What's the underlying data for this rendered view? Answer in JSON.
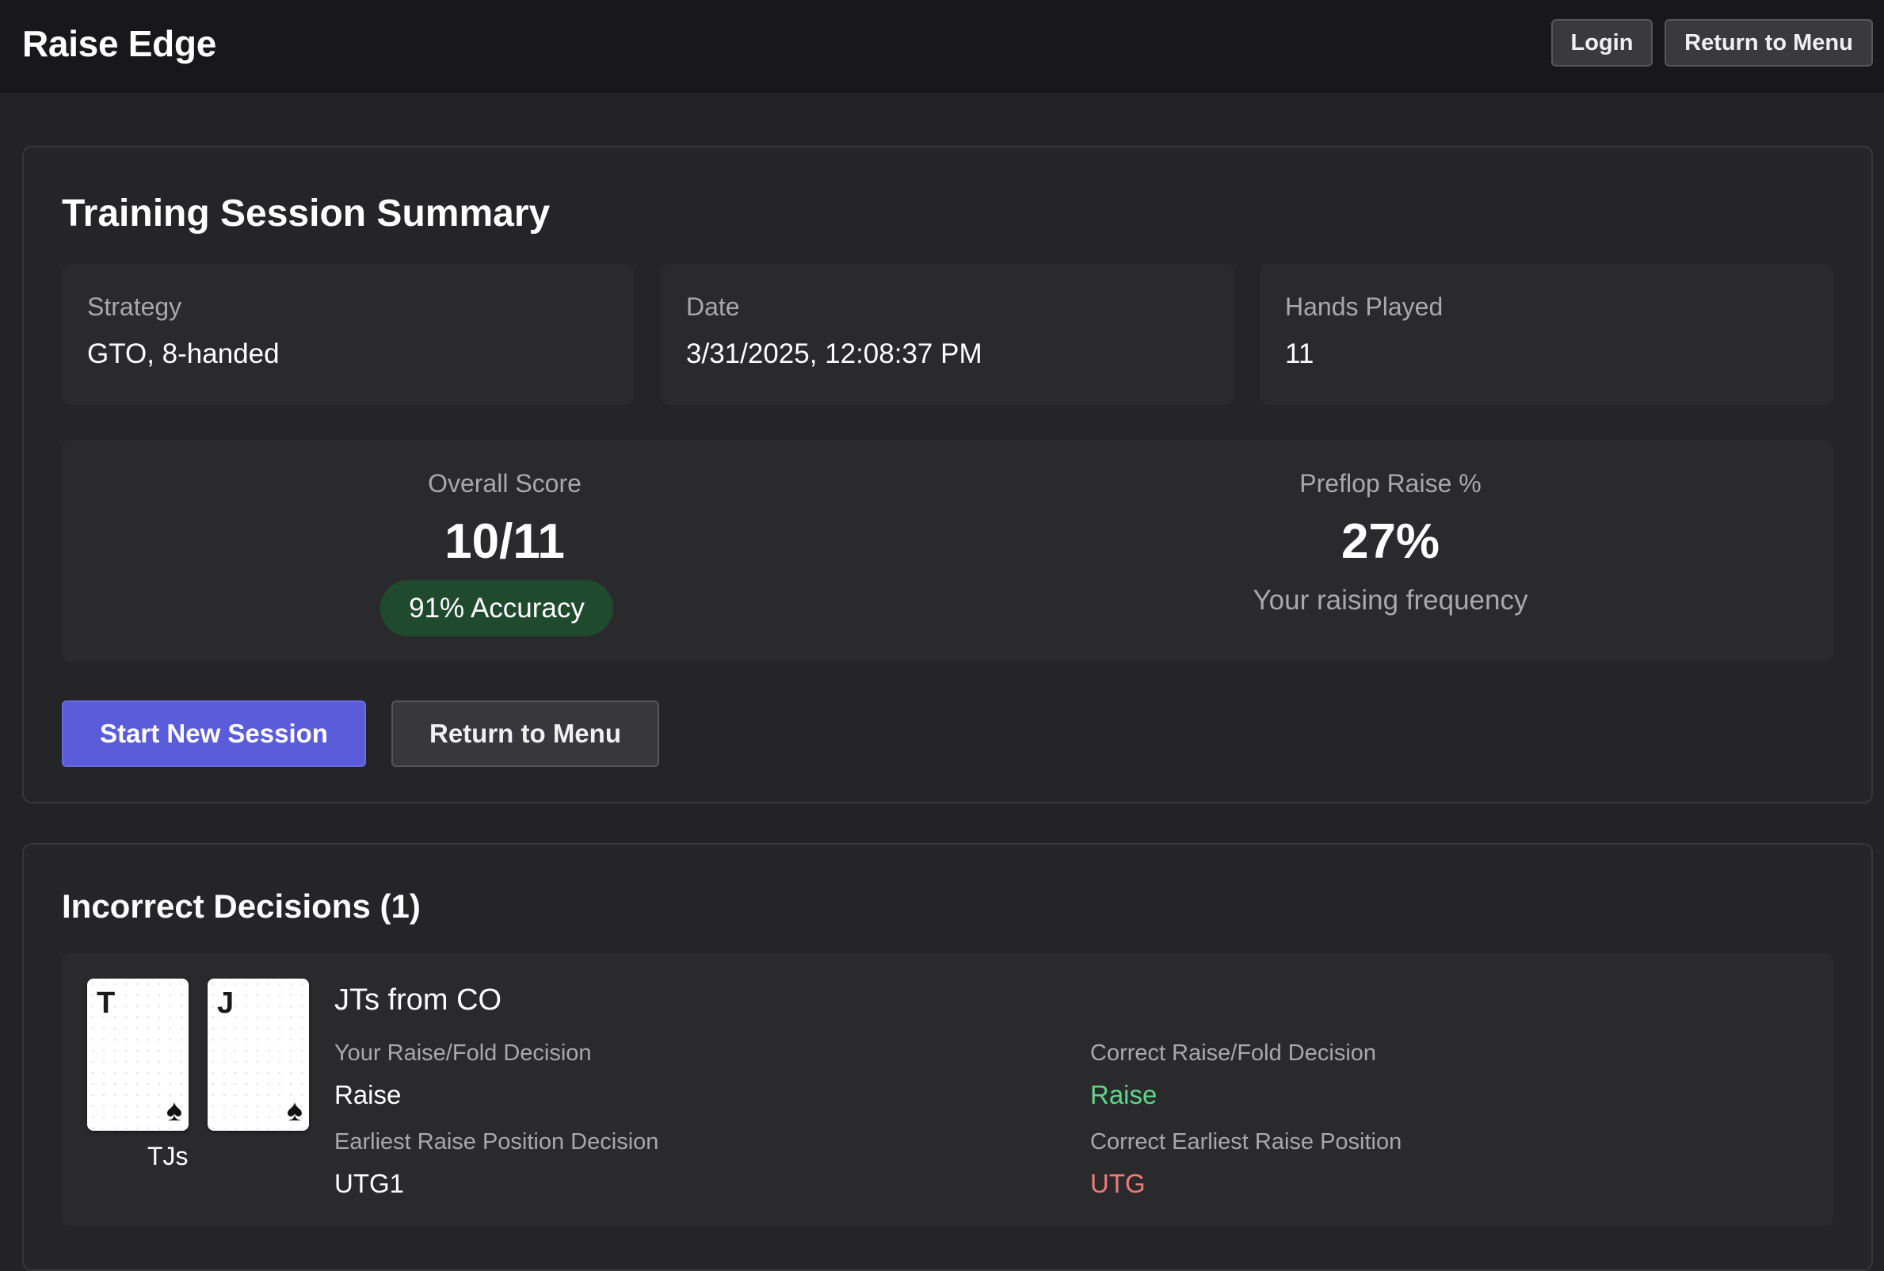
{
  "header": {
    "brand": "Raise Edge",
    "login_label": "Login",
    "return_label": "Return to Menu"
  },
  "summary": {
    "title": "Training Session Summary",
    "meta": [
      {
        "label": "Strategy",
        "value": "GTO, 8-handed"
      },
      {
        "label": "Date",
        "value": "3/31/2025, 12:08:37 PM"
      },
      {
        "label": "Hands Played",
        "value": "11"
      }
    ],
    "score": {
      "label": "Overall Score",
      "value": "10/11",
      "accuracy": "91% Accuracy"
    },
    "raise": {
      "label": "Preflop Raise %",
      "value": "27%",
      "subtitle": "Your raising frequency"
    },
    "start_label": "Start New Session",
    "return_label": "Return to Menu"
  },
  "incorrect": {
    "title": "Incorrect Decisions (1)",
    "items": [
      {
        "cards": [
          {
            "rank": "T",
            "suit": "♠"
          },
          {
            "rank": "J",
            "suit": "♠"
          }
        ],
        "hand": "TJs",
        "title": "JTs from CO",
        "your_decision_label": "Your Raise/Fold Decision",
        "your_decision": "Raise",
        "correct_decision_label": "Correct Raise/Fold Decision",
        "correct_decision": "Raise",
        "your_position_label": "Earliest Raise Position Decision",
        "your_position": "UTG1",
        "correct_position_label": "Correct Earliest Raise Position",
        "correct_position": "UTG"
      }
    ]
  },
  "colors": {
    "correct": "#5fd68a",
    "incorrect": "#f07a7a",
    "primary": "#5a5cd9",
    "badge": "#1f4a2d"
  }
}
